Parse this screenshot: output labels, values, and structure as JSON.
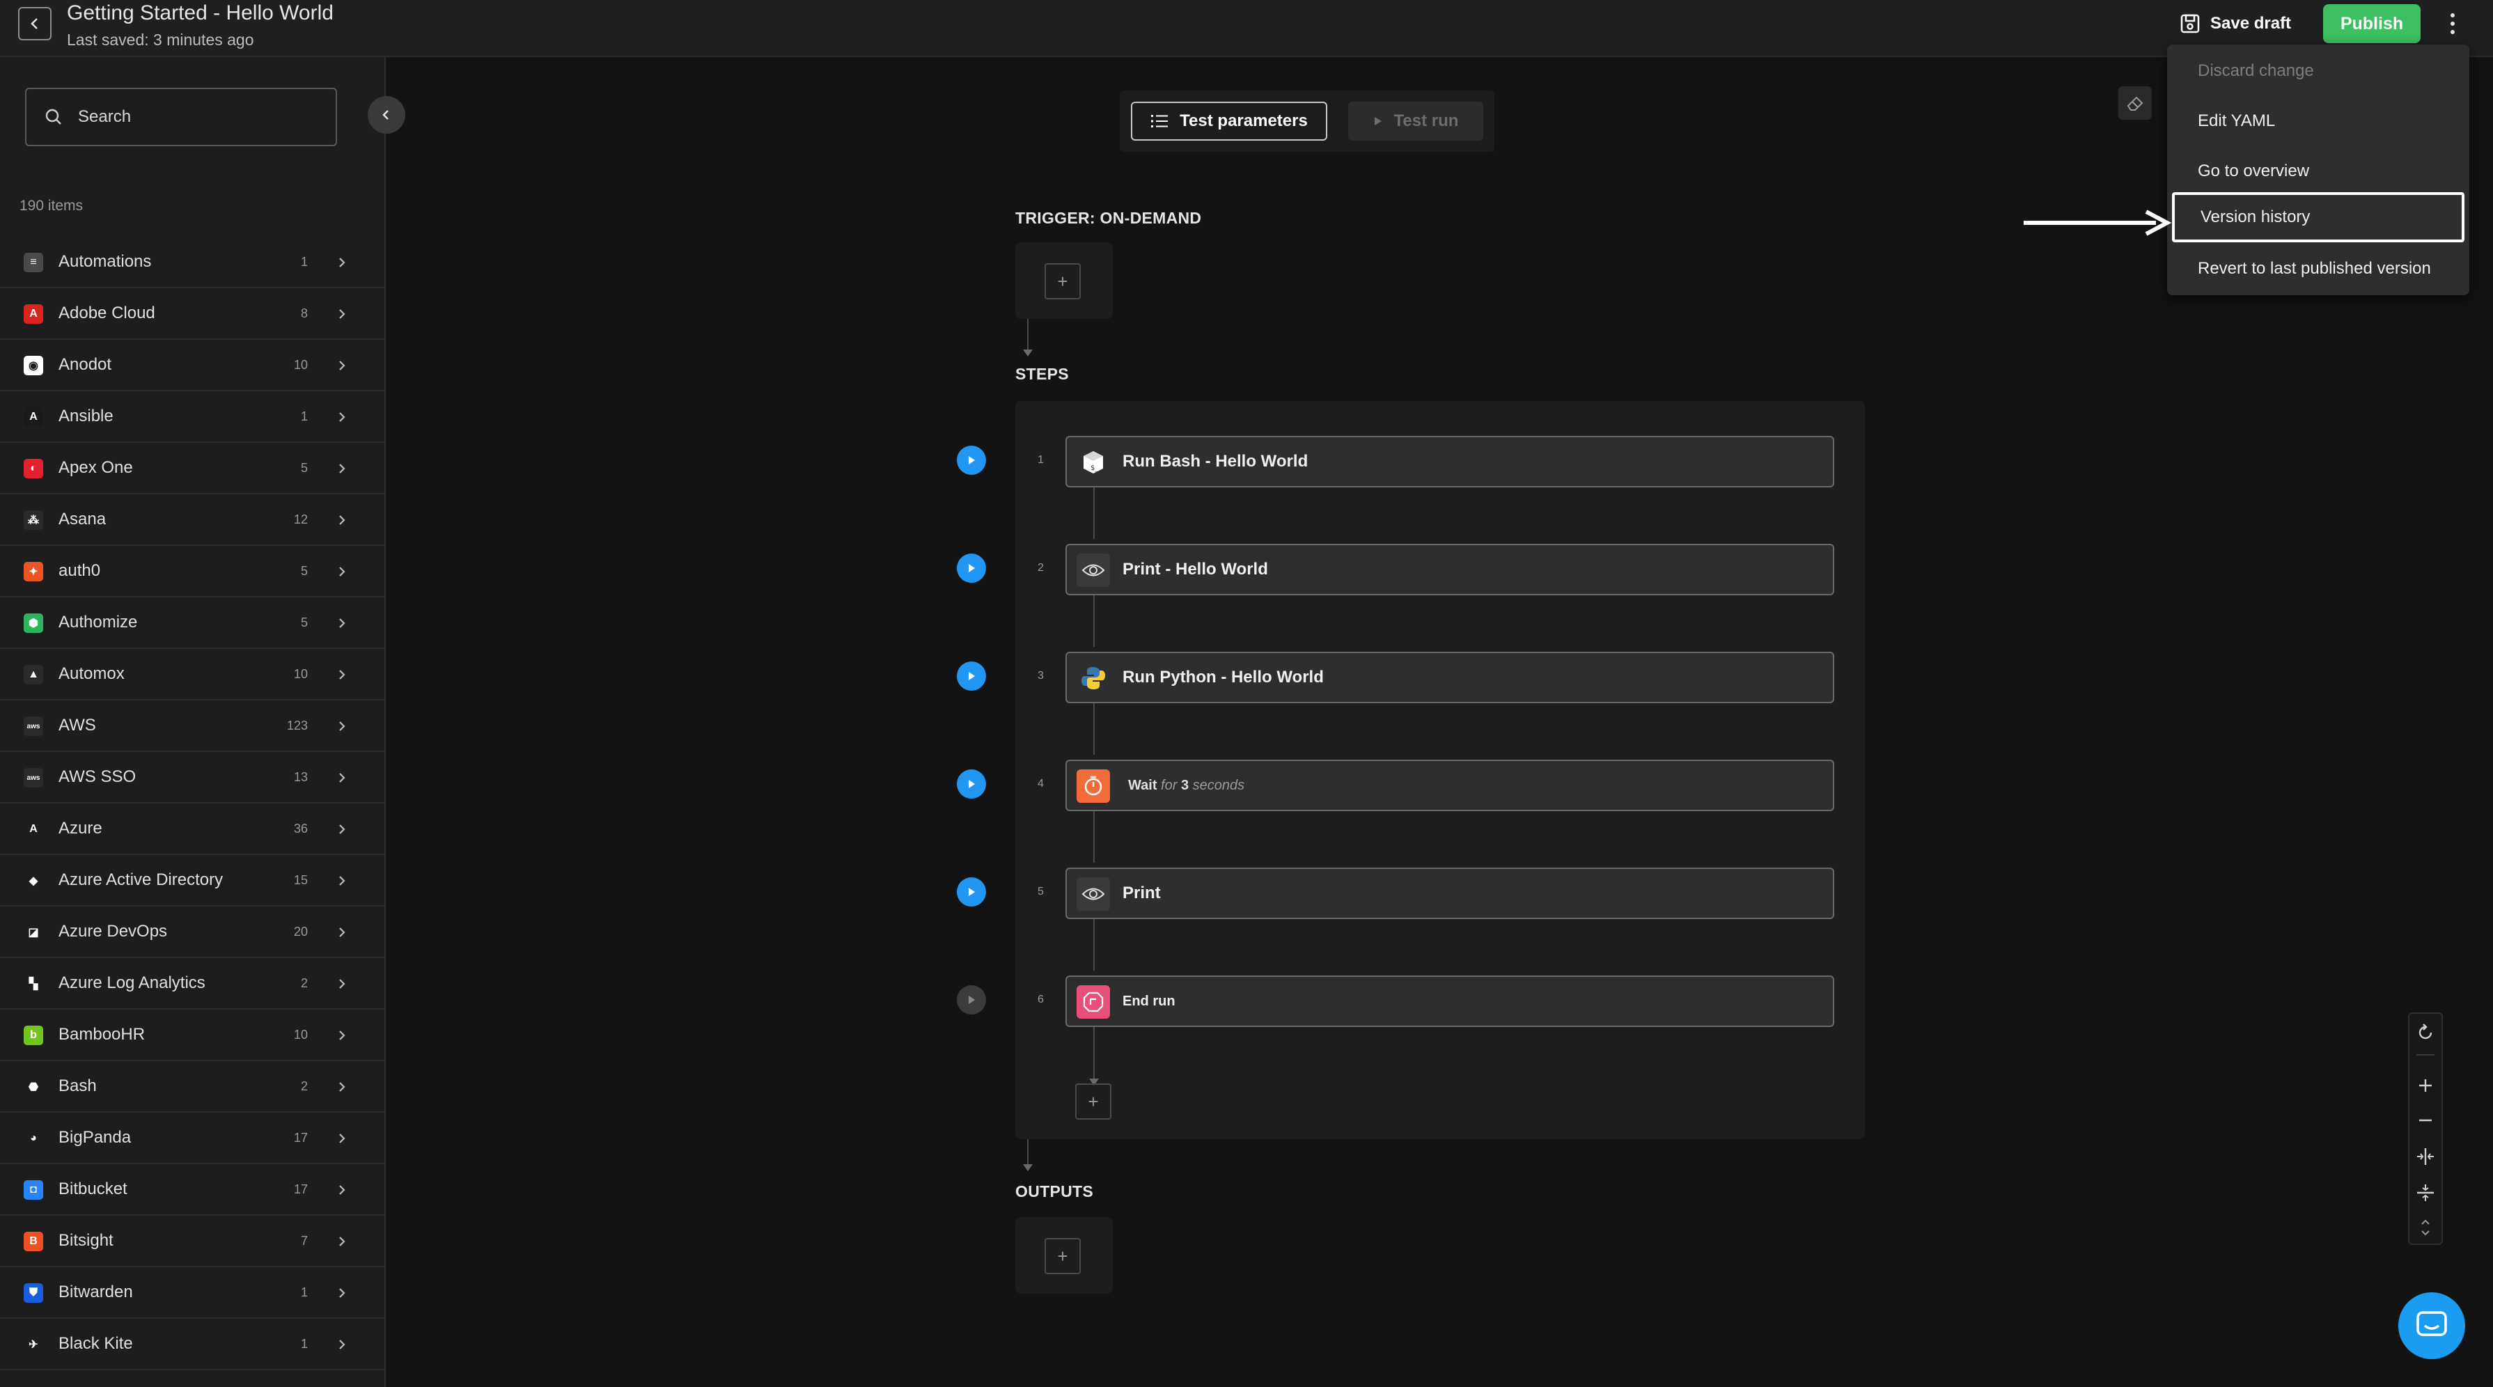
{
  "header": {
    "title": "Getting Started - Hello World",
    "subtitle": "Last saved: 3 minutes ago",
    "save_draft_label": "Save draft",
    "publish_label": "Publish"
  },
  "sidebar": {
    "search_placeholder": "Search",
    "items_count": "190 items",
    "items": [
      {
        "label": "Automations",
        "count": "1",
        "color": "#4a4a4a",
        "glyph": "≡"
      },
      {
        "label": "Adobe Cloud",
        "count": "8",
        "color": "#d9251c",
        "glyph": "A"
      },
      {
        "label": "Anodot",
        "count": "10",
        "color": "#ffffff",
        "glyph": "◉"
      },
      {
        "label": "Ansible",
        "count": "1",
        "color": "#1a1a1a",
        "glyph": "A"
      },
      {
        "label": "Apex One",
        "count": "5",
        "color": "#e5202e",
        "glyph": "◐"
      },
      {
        "label": "Asana",
        "count": "12",
        "color": "#2a2a2a",
        "glyph": "⁂"
      },
      {
        "label": "auth0",
        "count": "5",
        "color": "#eb5424",
        "glyph": "✦"
      },
      {
        "label": "Authomize",
        "count": "5",
        "color": "#2db55d",
        "glyph": "⬢"
      },
      {
        "label": "Automox",
        "count": "10",
        "color": "#2a2a2a",
        "glyph": "▲"
      },
      {
        "label": "AWS",
        "count": "123",
        "color": "#2a2a2a",
        "glyph": "aws"
      },
      {
        "label": "AWS SSO",
        "count": "13",
        "color": "#2a2a2a",
        "glyph": "aws"
      },
      {
        "label": "Azure",
        "count": "36",
        "color": "#1d1d1d",
        "glyph": "A"
      },
      {
        "label": "Azure Active Directory",
        "count": "15",
        "color": "#1d1d1d",
        "glyph": "◆"
      },
      {
        "label": "Azure DevOps",
        "count": "20",
        "color": "#1d1d1d",
        "glyph": "◪"
      },
      {
        "label": "Azure Log Analytics",
        "count": "2",
        "color": "#1d1d1d",
        "glyph": "▚"
      },
      {
        "label": "BambooHR",
        "count": "10",
        "color": "#73c41d",
        "glyph": "b"
      },
      {
        "label": "Bash",
        "count": "2",
        "color": "#1d1d1d",
        "glyph": "⬣"
      },
      {
        "label": "BigPanda",
        "count": "17",
        "color": "#1d1d1d",
        "glyph": "◕"
      },
      {
        "label": "Bitbucket",
        "count": "17",
        "color": "#2684ff",
        "glyph": "◘"
      },
      {
        "label": "Bitsight",
        "count": "7",
        "color": "#f04e23",
        "glyph": "B"
      },
      {
        "label": "Bitwarden",
        "count": "1",
        "color": "#175ddc",
        "glyph": "⛊"
      },
      {
        "label": "Black Kite",
        "count": "1",
        "color": "#1d1d1d",
        "glyph": "✈"
      }
    ]
  },
  "canvas": {
    "test_parameters_label": "Test parameters",
    "test_run_label": "Test run",
    "trigger_label": "TRIGGER: ON-DEMAND",
    "steps_label": "STEPS",
    "outputs_label": "OUTPUTS",
    "plus": "+",
    "steps": [
      {
        "num": "1",
        "label": "Run Bash - Hello World",
        "icon": "bash-icon"
      },
      {
        "num": "2",
        "label": "Print - Hello World",
        "icon": "eye-icon"
      },
      {
        "num": "3",
        "label": "Run Python - Hello World",
        "icon": "python-icon"
      },
      {
        "num": "4",
        "label": "Wait",
        "icon": "timer-icon",
        "wait_for": "for",
        "wait_value": "3",
        "wait_unit": "seconds"
      },
      {
        "num": "5",
        "label": "Print",
        "icon": "eye-icon"
      },
      {
        "num": "6",
        "label": "End run",
        "icon": "stop-icon"
      }
    ]
  },
  "menu": {
    "items": [
      {
        "label": "Discard change",
        "disabled": true
      },
      {
        "label": "Edit YAML"
      },
      {
        "label": "Go to overview"
      },
      {
        "label": "Version history",
        "highlighted": true
      },
      {
        "label": "Revert to last published version"
      }
    ]
  },
  "colors": {
    "accent_green": "#3dbf62",
    "accent_blue": "#2196f3",
    "wait_orange": "#f26b3a",
    "end_pink": "#e8507a"
  }
}
